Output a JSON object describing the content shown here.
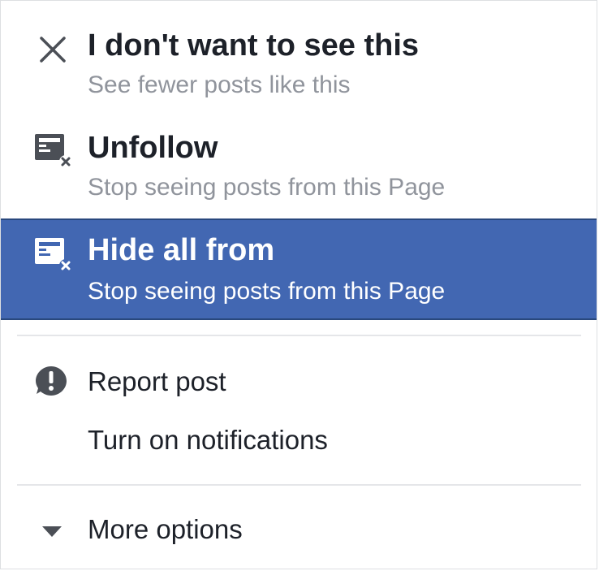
{
  "menu": {
    "items": [
      {
        "icon": "close-icon",
        "title": "I don't want to see this",
        "subtitle": "See fewer posts like this"
      },
      {
        "icon": "unfollow-page-icon",
        "title": "Unfollow",
        "subtitle": "Stop seeing posts from this Page"
      },
      {
        "icon": "hide-page-icon",
        "title": "Hide all from",
        "subtitle": "Stop seeing posts from this Page",
        "highlighted": true
      }
    ],
    "secondary": [
      {
        "icon": "report-alert-icon",
        "label": "Report post"
      },
      {
        "icon": "",
        "label": "Turn on notifications"
      }
    ],
    "more": {
      "icon": "caret-down-icon",
      "label": "More options"
    }
  },
  "colors": {
    "highlight_bg": "#4267b2",
    "highlight_border": "#29487d",
    "icon_dark": "#4b4f56",
    "subtitle_gray": "#90949c",
    "divider": "#e5e6e9"
  }
}
